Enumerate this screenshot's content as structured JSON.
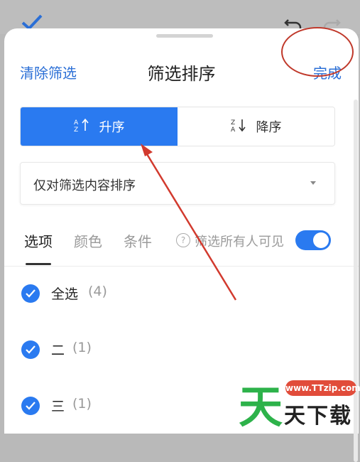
{
  "header": {
    "clear_label": "清除筛选",
    "title": "筛选排序",
    "done_label": "完成"
  },
  "sort": {
    "asc_icon": "A↕Z↑",
    "asc_label": "升序",
    "desc_icon": "Z↕A↓",
    "desc_label": "降序",
    "selected": "asc"
  },
  "scope_dropdown": {
    "value": "仅对筛选内容排序"
  },
  "tabs": [
    {
      "label": "选项",
      "active": true
    },
    {
      "label": "颜色",
      "active": false
    },
    {
      "label": "条件",
      "active": false
    }
  ],
  "visibility": {
    "label": "筛选所有人可见",
    "enabled": true
  },
  "options": [
    {
      "label": "全选",
      "count": "(4)",
      "checked": true
    },
    {
      "label": "二",
      "count": "(1)",
      "checked": true
    },
    {
      "label": "三",
      "count": "(1)",
      "checked": true
    }
  ],
  "watermark": {
    "site": "www.TTzip.com",
    "glyph": "天",
    "text": "天下载"
  },
  "colors": {
    "accent": "#2a7af0",
    "link": "#2b6fd6",
    "annotation": "#c0392b"
  }
}
